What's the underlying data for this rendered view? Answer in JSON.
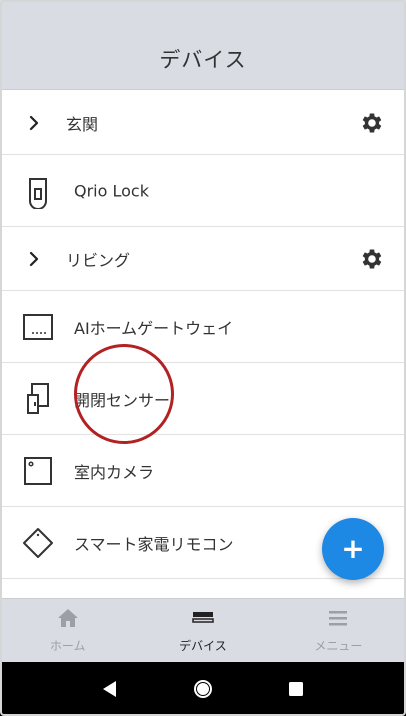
{
  "header": {
    "title": "デバイス"
  },
  "list": {
    "groups": [
      {
        "label": "玄関",
        "chevron": "chevron-right-icon",
        "settings_icon": "gear-icon"
      },
      {
        "label": "リビング",
        "chevron": "chevron-right-icon",
        "settings_icon": "gear-icon"
      }
    ],
    "devices": [
      {
        "label": "Qrio Lock",
        "icon": "smart-lock-icon"
      },
      {
        "label": "AIホームゲートウェイ",
        "icon": "gateway-icon"
      },
      {
        "label": "開閉センサー",
        "icon": "door-sensor-icon"
      },
      {
        "label": "室内カメラ",
        "icon": "camera-icon"
      },
      {
        "label": "スマート家電リモコン",
        "icon": "remote-icon"
      }
    ]
  },
  "fab": {
    "glyph": "+",
    "icon": "add-icon"
  },
  "bottom_nav": {
    "items": [
      {
        "label": "ホーム",
        "icon": "home-icon",
        "active": false
      },
      {
        "label": "デバイス",
        "icon": "devices-icon",
        "active": true
      },
      {
        "label": "メニュー",
        "icon": "menu-icon",
        "active": false
      }
    ]
  },
  "colors": {
    "accent": "#1e88e5",
    "header_bg": "#d9dde3",
    "annotation": "#b22222"
  }
}
